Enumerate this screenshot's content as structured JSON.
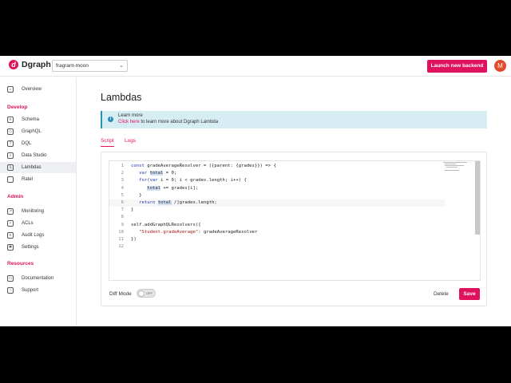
{
  "header": {
    "logo_text": "Dgraph",
    "backend_name": "fragrant-moon",
    "launch_label": "Launch new backend",
    "avatar_initial": "M",
    "accent_color": "#e0125e"
  },
  "sidebar": {
    "items_top": [
      {
        "label": "Overview",
        "icon": "home-icon"
      }
    ],
    "sections": [
      {
        "title": "Develop",
        "items": [
          {
            "label": "Schema",
            "icon": "database-icon"
          },
          {
            "label": "GraphQL",
            "icon": "graphql-icon"
          },
          {
            "label": "DQL",
            "icon": "query-icon"
          },
          {
            "label": "Data Studio",
            "icon": "search-icon"
          },
          {
            "label": "Lambdas",
            "icon": "lambda-icon",
            "active": true
          },
          {
            "label": "Ratel",
            "icon": "ratel-icon"
          }
        ]
      },
      {
        "title": "Admin",
        "items": [
          {
            "label": "Monitoring",
            "icon": "chart-icon"
          },
          {
            "label": "ACLs",
            "icon": "lock-icon"
          },
          {
            "label": "Audit Logs",
            "icon": "logs-icon"
          },
          {
            "label": "Settings",
            "icon": "gear-icon"
          }
        ]
      },
      {
        "title": "Resources",
        "items": [
          {
            "label": "Documentation",
            "icon": "book-icon"
          },
          {
            "label": "Support",
            "icon": "support-icon"
          }
        ]
      }
    ]
  },
  "main": {
    "title": "Lambdas",
    "info": {
      "title": "Learn more",
      "link_text": "Click here",
      "text": " to learn more about Dgraph Lambda"
    },
    "tabs": [
      {
        "label": "Script",
        "active": true
      },
      {
        "label": "Logs",
        "active": false
      }
    ],
    "code_lines": [
      {
        "n": "1",
        "html": "<span class=\"kw\">const</span> gradeAverageResolver = ({parent: {grades}}) => {"
      },
      {
        "n": "2",
        "html": "   <span class=\"kw\">var</span> <span class=\"hl\">total</span> = 0;"
      },
      {
        "n": "3",
        "html": "   <span class=\"kw\">for</span>(<span class=\"kw\">var</span> i = 0; i < grades.length; i++) {"
      },
      {
        "n": "4",
        "html": "      <span class=\"hl\">total</span> += grades[i];"
      },
      {
        "n": "5",
        "html": "   }"
      },
      {
        "n": "6",
        "html": "   <span class=\"kw\">return</span> <span class=\"hl\">total</span> /]grades.length;",
        "current": true
      },
      {
        "n": "7",
        "html": "}"
      },
      {
        "n": "8",
        "html": ""
      },
      {
        "n": "9",
        "html": "self.addGraphQLResolvers({"
      },
      {
        "n": "10",
        "html": "   <span class=\"str\">\"Student.gradeAverage\"</span>: gradeAverageResolver"
      },
      {
        "n": "11",
        "html": "})"
      },
      {
        "n": "12",
        "html": ""
      }
    ],
    "diff_mode_label": "Diff Mode",
    "toggle_text": "OFF",
    "delete_label": "Delete",
    "save_label": "Save"
  }
}
